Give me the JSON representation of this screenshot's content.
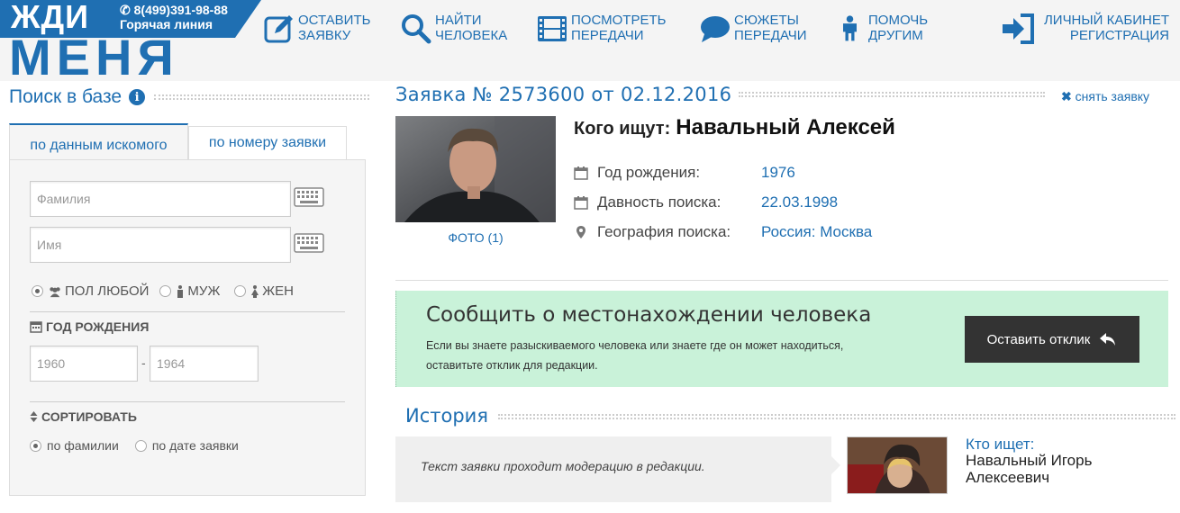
{
  "colors": {
    "brand": "#1f6fb2",
    "report_bg": "#c9f2d9",
    "button_dark": "#333333"
  },
  "logo": {
    "word1": "ЖДИ",
    "word2": "МЕНЯ",
    "phone": "8(499)391-98-88",
    "hotline": "Горячая линия"
  },
  "nav": [
    {
      "icon": "edit-icon",
      "line1": "Оставить",
      "line2": "заявку"
    },
    {
      "icon": "search-icon",
      "line1": "Найти",
      "line2": "человека"
    },
    {
      "icon": "film-icon",
      "line1": "Посмотреть",
      "line2": "передачи"
    },
    {
      "icon": "chat-icon",
      "line1": "Сюжеты",
      "line2": "передачи"
    },
    {
      "icon": "person-icon",
      "line1": "Помочь",
      "line2": "другим"
    }
  ],
  "account": {
    "icon": "login-icon",
    "line1": "Личный кабинет",
    "line2": "Регистрация"
  },
  "sidebar": {
    "title": "Поиск в базе",
    "tabs": [
      "по данным искомого",
      "по номеру заявки"
    ],
    "surname_placeholder": "Фамилия",
    "name_placeholder": "Имя",
    "gender": {
      "any": "ПОЛ ЛЮБОЙ",
      "male": "МУЖ",
      "female": "ЖЕН",
      "selected": "any"
    },
    "birth_label": "ГОД РОЖДЕНИЯ",
    "year_from": "1960",
    "year_dash": "-",
    "year_to": "1964",
    "sort_label": "СОРТИРОВАТЬ",
    "sort_by_surname": "по фамилии",
    "sort_by_date": "по дате заявки",
    "sort_selected": "surname"
  },
  "request": {
    "title": "Заявка № 2573600 от 02.12.2016",
    "remove": "снять заявку",
    "photo_caption": "ФОТО (1)",
    "who_label": "Кого ищут:",
    "who_name": "Навальный Алексей",
    "facts": [
      {
        "icon": "calendar-icon",
        "label": "Год рождения:",
        "value": "1976"
      },
      {
        "icon": "calendar-icon",
        "label": "Давность поиска:",
        "value": "22.03.1998"
      },
      {
        "icon": "map-pin-icon",
        "label": "География поиска:",
        "value": "Россия: Москва"
      }
    ]
  },
  "report": {
    "title": "Сообщить о местонахождении человека",
    "text": "Если вы знаете разыскиваемого человека или знаете где он может находиться, оставитьте отклик для редакции.",
    "button": "Оставить отклик"
  },
  "history": {
    "title": "История",
    "message": "Текст заявки проходит модерацию в редакции.",
    "searcher_label": "Кто ищет:",
    "searcher_name": "Навальный Игорь Алексеевич"
  }
}
